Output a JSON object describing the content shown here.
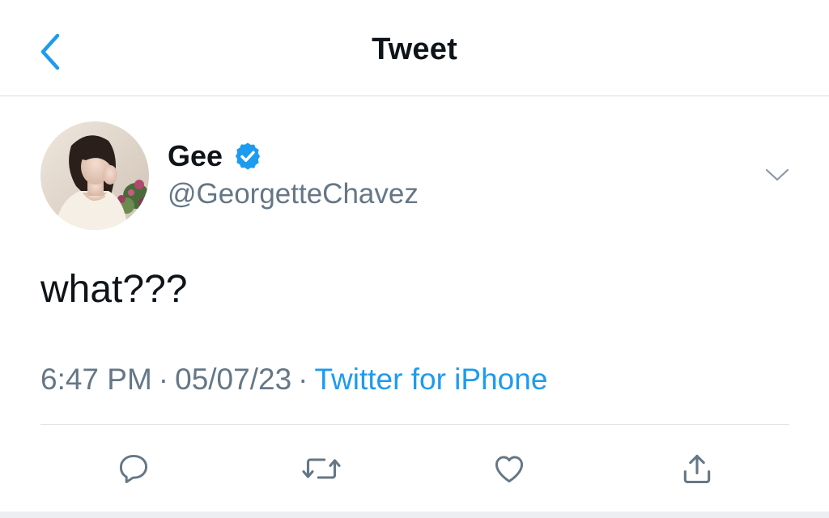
{
  "header": {
    "title": "Tweet",
    "back_icon": "chevron-left-icon",
    "accent_color": "#1d9bf0"
  },
  "author": {
    "display_name": "Gee",
    "handle": "@GeorgetteChavez",
    "verified": true,
    "verified_icon": "verified-badge-icon",
    "verified_color": "#1d9bf0"
  },
  "tweet": {
    "text": "what???"
  },
  "meta": {
    "time": "6:47 PM",
    "separator": "·",
    "date": "05/07/23",
    "source": "Twitter for iPhone"
  },
  "actions": [
    {
      "name": "reply",
      "icon": "reply-icon"
    },
    {
      "name": "retweet",
      "icon": "retweet-icon"
    },
    {
      "name": "like",
      "icon": "heart-icon"
    },
    {
      "name": "share",
      "icon": "share-icon"
    }
  ],
  "colors": {
    "text_primary": "#0f1419",
    "text_secondary": "#657786",
    "link": "#1d9bf0",
    "divider": "#d9dde1"
  }
}
